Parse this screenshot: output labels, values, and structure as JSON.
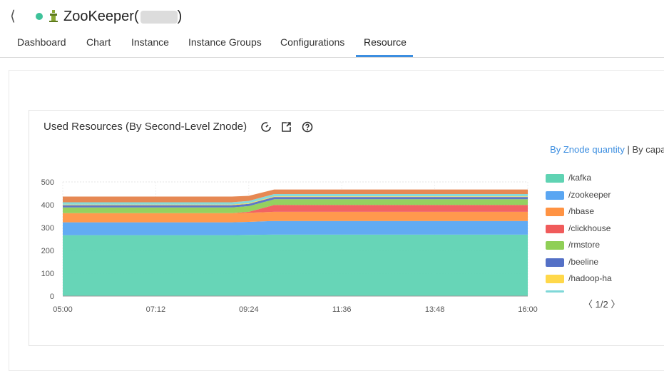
{
  "header": {
    "title": "ZooKeeper(",
    "title_suffix": ")",
    "status_color": "#3ec29a"
  },
  "tabs": [
    {
      "label": "Dashboard"
    },
    {
      "label": "Chart"
    },
    {
      "label": "Instance"
    },
    {
      "label": "Instance Groups"
    },
    {
      "label": "Configurations"
    },
    {
      "label": "Resource",
      "active": true
    }
  ],
  "panel": {
    "title": "Used Resources (By Second-Level Znode)",
    "switch_quantity": "By Znode quantity",
    "switch_separator": "|",
    "switch_capacity": "By capacity"
  },
  "pager": {
    "text": "1/2",
    "prev": "〈",
    "next": "〉"
  },
  "chart_data": {
    "type": "area",
    "stacked": true,
    "x": [
      "05:00",
      "06:00",
      "07:12",
      "08:00",
      "09:00",
      "09:24",
      "10:00",
      "11:00",
      "11:36",
      "12:00",
      "13:00",
      "13:48",
      "14:00",
      "15:00",
      "16:00"
    ],
    "x_ticks": [
      "05:00",
      "07:12",
      "09:24",
      "11:36",
      "13:48",
      "16:00"
    ],
    "y_ticks": [
      "0",
      "100",
      "200",
      "300",
      "400",
      "500"
    ],
    "ylim": [
      0,
      500
    ],
    "grid": true,
    "legend_position": "right",
    "series": [
      {
        "name": "/kafka",
        "color": "#5fd3b3",
        "values": [
          267,
          267,
          267,
          267,
          267,
          268,
          269,
          269,
          269,
          269,
          269,
          269,
          269,
          269,
          269
        ]
      },
      {
        "name": "/zookeeper",
        "color": "#5aa6f2",
        "values": [
          56,
          56,
          56,
          56,
          56,
          57,
          60,
          60,
          60,
          60,
          60,
          60,
          60,
          60,
          60
        ]
      },
      {
        "name": "/hbase",
        "color": "#ff9343",
        "values": [
          40,
          40,
          40,
          40,
          40,
          40,
          40,
          40,
          40,
          40,
          40,
          40,
          40,
          40,
          40
        ]
      },
      {
        "name": "/clickhouse",
        "color": "#f05b5b",
        "values": [
          0,
          0,
          0,
          0,
          0,
          4,
          30,
          30,
          30,
          30,
          30,
          30,
          30,
          30,
          30
        ]
      },
      {
        "name": "/rmstore",
        "color": "#8fcf56",
        "values": [
          25,
          25,
          25,
          25,
          25,
          25,
          25,
          25,
          25,
          25,
          25,
          25,
          25,
          25,
          25
        ]
      },
      {
        "name": "/beeline",
        "color": "#5470c6",
        "values": [
          10,
          10,
          10,
          10,
          10,
          10,
          10,
          10,
          10,
          10,
          10,
          10,
          10,
          10,
          10
        ]
      },
      {
        "name": "/hadoop-ha",
        "color": "#ffd84a",
        "values": [
          3,
          3,
          3,
          3,
          3,
          3,
          3,
          3,
          3,
          3,
          3,
          3,
          3,
          3,
          3
        ]
      },
      {
        "name": "",
        "color": "#7fd8d8",
        "values": [
          10,
          10,
          10,
          10,
          10,
          10,
          10,
          10,
          10,
          10,
          10,
          10,
          10,
          10,
          10
        ]
      },
      {
        "name": "",
        "color": "#e5824a",
        "values": [
          25,
          25,
          25,
          25,
          25,
          22,
          20,
          20,
          20,
          20,
          20,
          20,
          20,
          20,
          20
        ]
      }
    ],
    "legend_visible": [
      "/kafka",
      "/zookeeper",
      "/hbase",
      "/clickhouse",
      "/rmstore",
      "/beeline",
      "/hadoop-ha"
    ]
  }
}
